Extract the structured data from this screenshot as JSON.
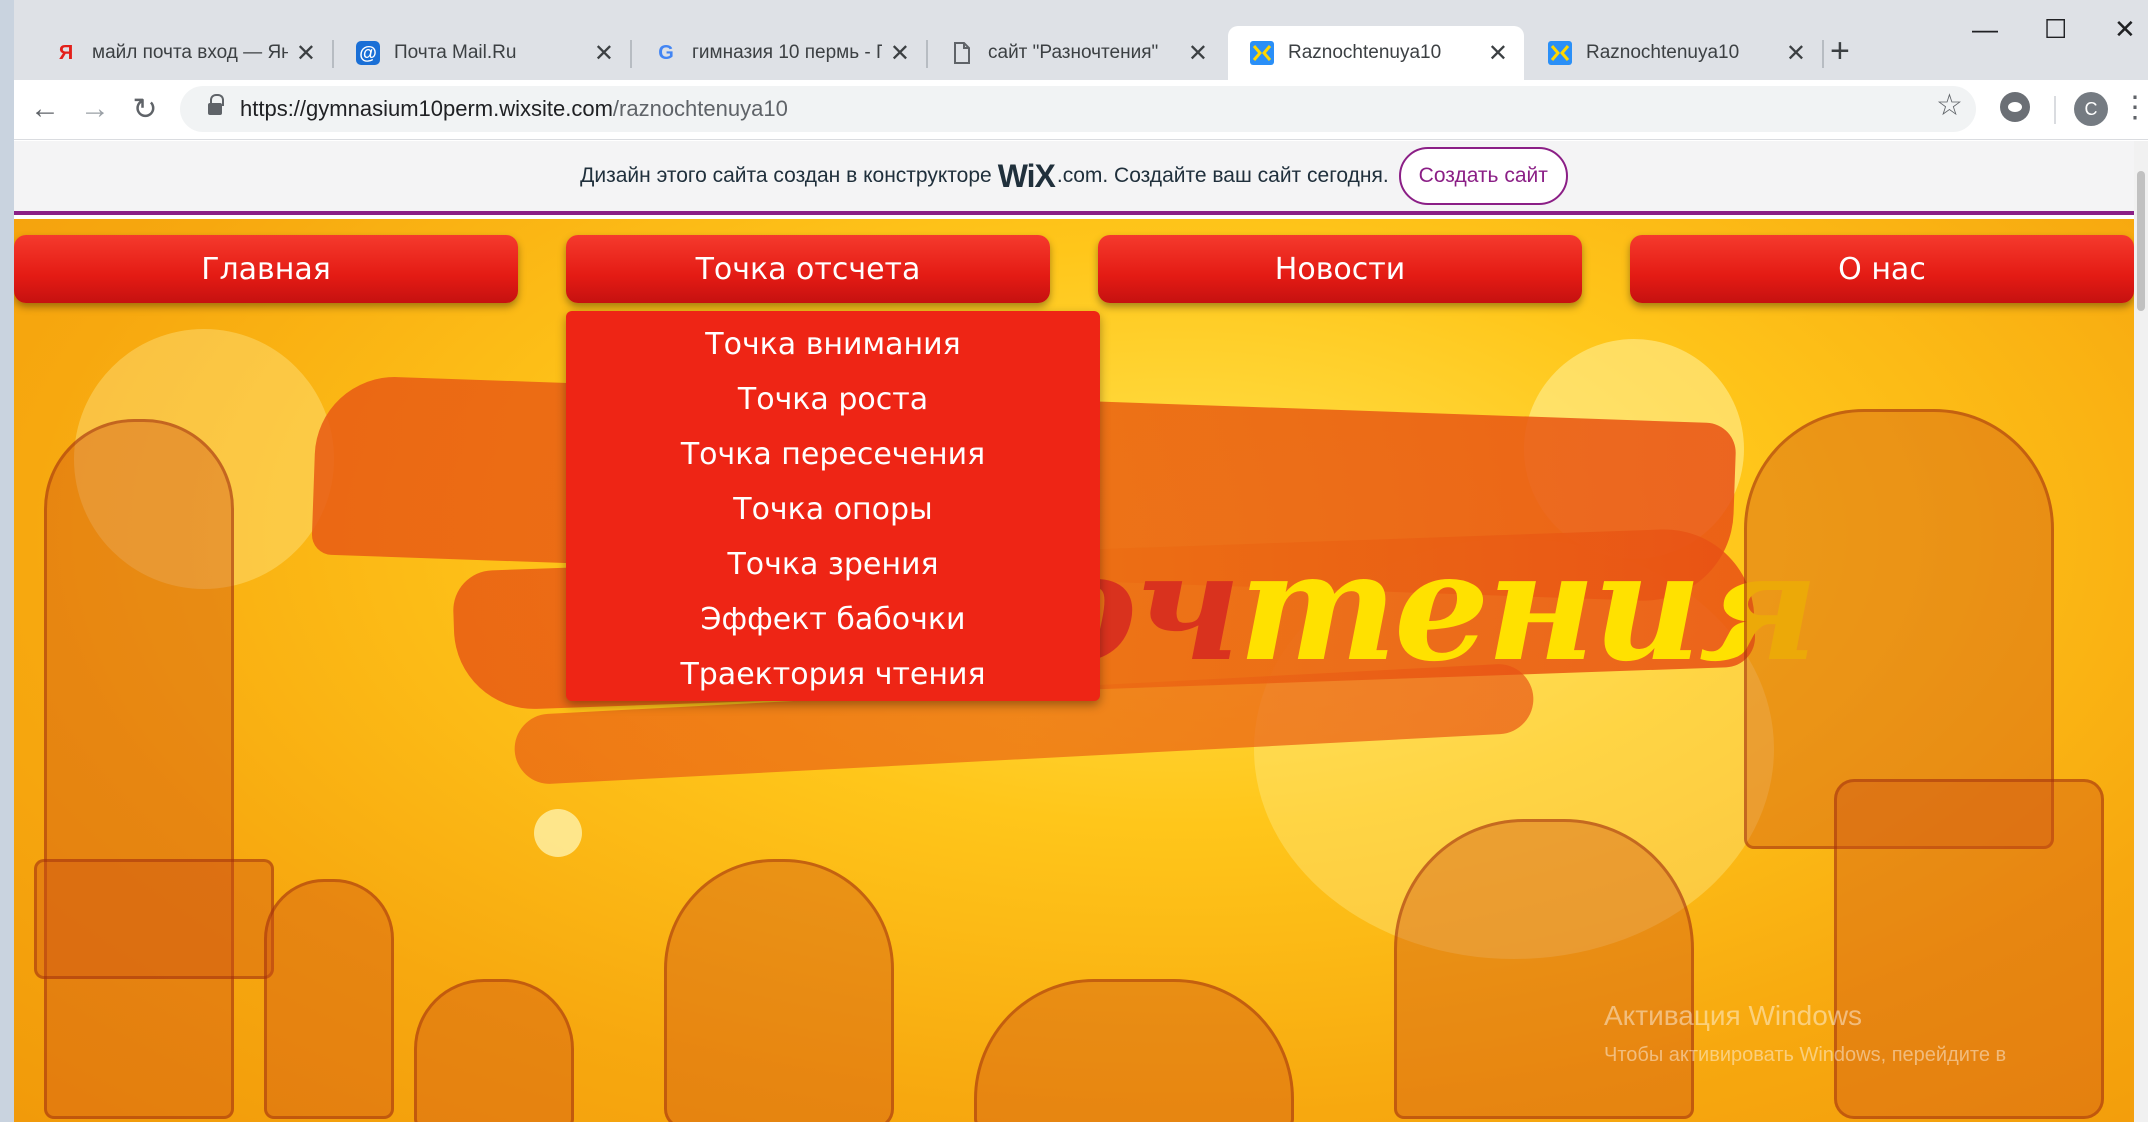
{
  "tabs": [
    {
      "favicon": "Я",
      "title": "майл почта вход — Ян",
      "active": false
    },
    {
      "favicon": "@",
      "title": "Почта Mail.Ru",
      "active": false
    },
    {
      "favicon": "G",
      "title": "гимназия 10 пермь - Г",
      "active": false
    },
    {
      "favicon": "page-icon",
      "title": "сайт \"Разночтения\"",
      "active": false
    },
    {
      "favicon": "wix-icon",
      "title": "Raznochtenuya10",
      "active": true
    },
    {
      "favicon": "wix-icon",
      "title": "Raznochtenuya10",
      "active": false
    }
  ],
  "window_controls": {
    "minimize": "—",
    "maximize": "☐",
    "close": "✕"
  },
  "toolbar": {
    "back": "←",
    "forward": "→",
    "reload": "↻",
    "url_host": "https://gymnasium10perm.wixsite.com",
    "url_path": "/raznochtenuya10",
    "star": "☆",
    "profile_initial": "C",
    "menu": "⋮"
  },
  "wix_banner": {
    "text_before": "Дизайн этого сайта создан в конструкторе",
    "logo": "WiX",
    "text_after": ".com. Создайте ваш сайт сегодня.",
    "button": "Создать сайт"
  },
  "nav": {
    "items": [
      "Главная",
      "Точка отсчета",
      "Новости",
      "О нас"
    ],
    "dropdown": [
      "Точка внимания",
      "Точка роста",
      "Точка пересечения",
      "Точка опоры",
      "Точка зрения",
      "Эффект бабочки",
      "Траектория чтения"
    ]
  },
  "hero": {
    "wordmark_part1": "Разноч",
    "wordmark_part2": "тения"
  },
  "watermark": {
    "line1": "Активация Windows",
    "line2": "Чтобы активировать Windows, перейдите в"
  },
  "colors": {
    "nav_red": "#e41b14",
    "wix_purple": "#8b1f86",
    "hero_yellow": "#ffc61a",
    "wordmark_yellow": "#ffe100"
  }
}
